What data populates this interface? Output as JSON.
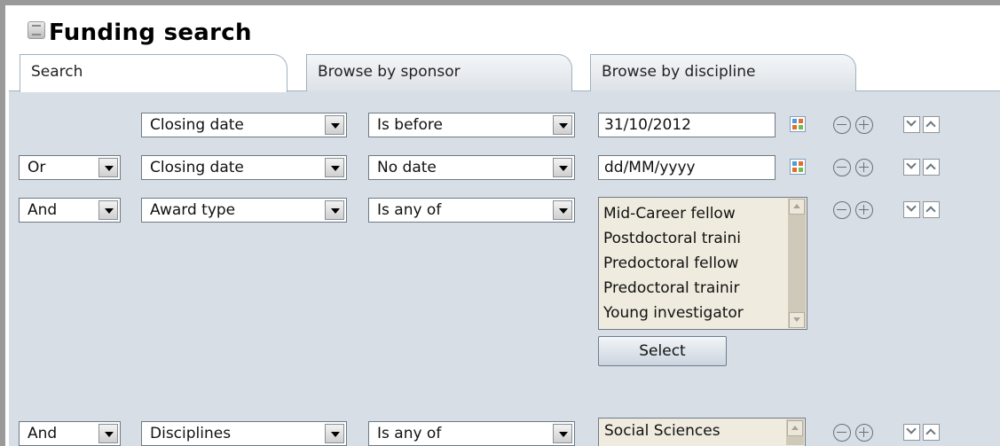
{
  "page": {
    "title": "Funding search"
  },
  "tabs": [
    {
      "label": "Search",
      "active": true
    },
    {
      "label": "Browse by sponsor",
      "active": false
    },
    {
      "label": "Browse by discipline",
      "active": false
    }
  ],
  "rows": [
    {
      "connector": "",
      "field": "Closing date",
      "operator": "Is before",
      "value": "31/10/2012"
    },
    {
      "connector": "Or",
      "field": "Closing date",
      "operator": "No date",
      "value": "dd/MM/yyyy"
    },
    {
      "connector": "And",
      "field": "Award type",
      "operator": "Is any of",
      "options": [
        "Mid-Career fellow",
        "Postdoctoral traini",
        "Predoctoral fellow",
        "Predoctoral trainir",
        "Young investigator"
      ],
      "select_button": "Select"
    },
    {
      "connector": "And",
      "field": "Disciplines",
      "operator": "Is any of",
      "options": [
        "Social Sciences"
      ]
    }
  ],
  "colors": {
    "panel_bg": "#d7dee5",
    "listbox_bg": "#efebdf",
    "tab_border": "#9fb0c0"
  }
}
